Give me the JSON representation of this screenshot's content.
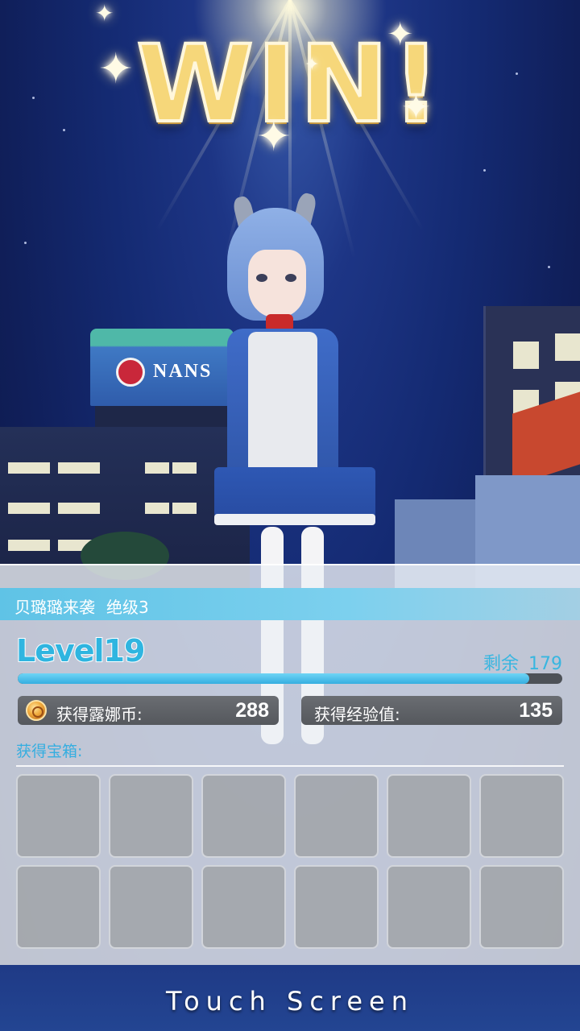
{
  "title": "WIN!",
  "stage": {
    "name": "贝璐璐来袭",
    "difficulty": "绝级3"
  },
  "level": {
    "label": "Level19",
    "remaining_label": "剩余",
    "remaining_value": "179",
    "progress_fraction": 0.94
  },
  "rewards": {
    "coin_label": "获得露娜币:",
    "coin_value": "288",
    "exp_label": "获得经验值:",
    "exp_value": "135",
    "chest_label": "获得宝箱:",
    "chest_slots": 12
  },
  "background_sign_text": "NANS",
  "prompt": "Touch Screen",
  "colors": {
    "accent": "#35aee0",
    "stage_bar": "#6ccbea",
    "win_gold": "#f6d77a",
    "panel": "#eef1f5"
  }
}
